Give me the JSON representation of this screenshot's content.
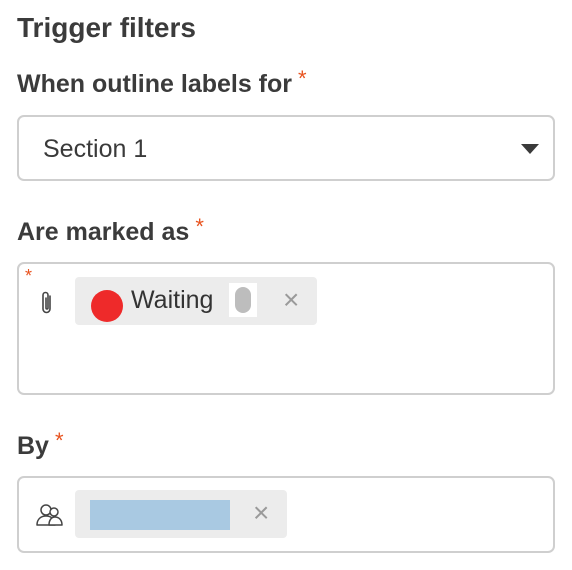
{
  "title": "Trigger filters",
  "outline": {
    "label": "When outline labels for",
    "required_mark": "*",
    "selected": "Section 1"
  },
  "marked": {
    "label": "Are marked as",
    "required_mark": "*",
    "status_chip": {
      "text": "Waiting",
      "color": "#ee2a2a",
      "remove": "×"
    }
  },
  "by": {
    "label": "By",
    "required_mark": "*",
    "user_chip": {
      "highlight_color": "#a9c9e2",
      "remove": "×"
    }
  }
}
